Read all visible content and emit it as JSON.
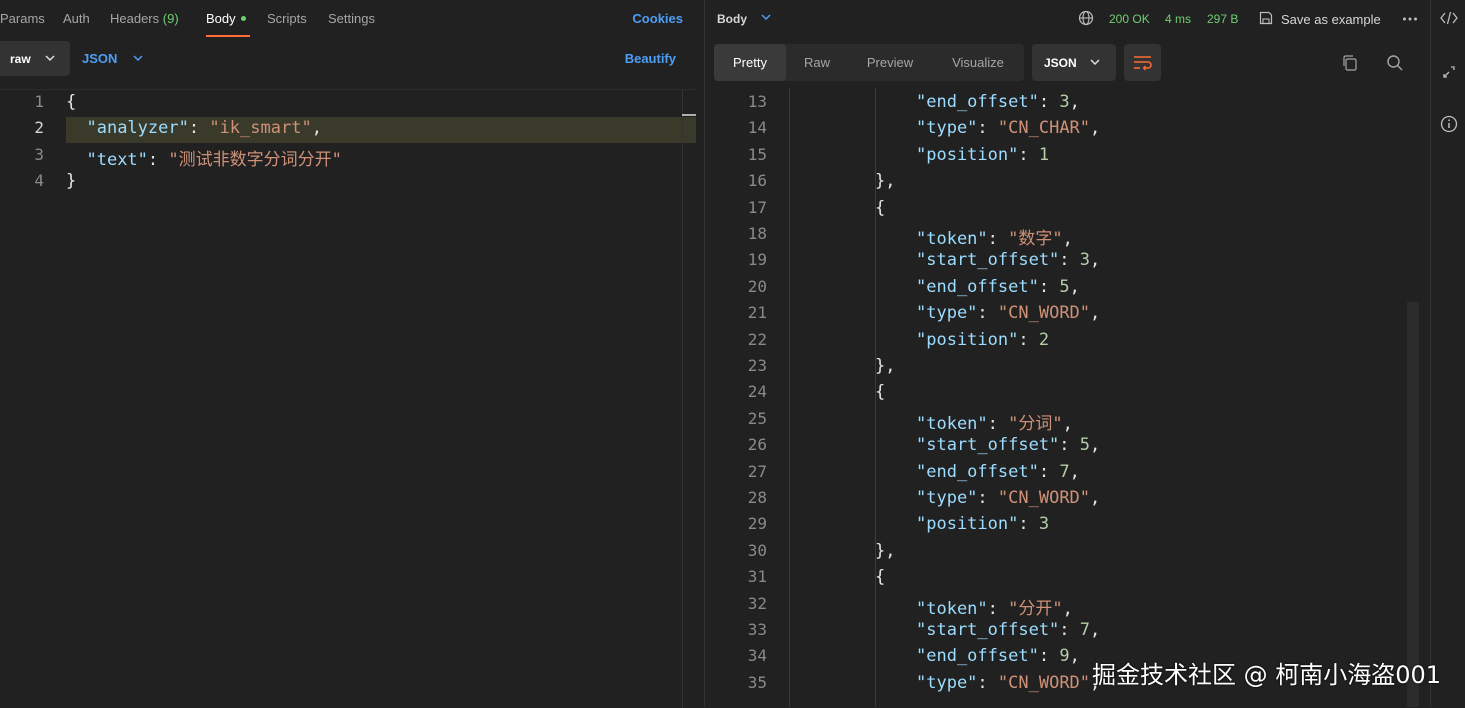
{
  "request_tabs": {
    "params": "Params",
    "auth": "Auth",
    "headers": "Headers",
    "headers_count": "(9)",
    "body": "Body",
    "scripts": "Scripts",
    "settings": "Settings",
    "cookies": "Cookies"
  },
  "body_toolbar": {
    "mode": "raw",
    "language": "JSON",
    "beautify": "Beautify"
  },
  "request_editor": {
    "lines": [
      {
        "n": "1",
        "parts": [
          {
            "t": "{",
            "c": "pun"
          }
        ]
      },
      {
        "n": "2",
        "parts": [
          {
            "t": "  ",
            "c": "pun"
          },
          {
            "t": "\"analyzer\"",
            "c": "key"
          },
          {
            "t": ": ",
            "c": "pun"
          },
          {
            "t": "\"ik_smart\"",
            "c": "str"
          },
          {
            "t": ",",
            "c": "pun"
          }
        ]
      },
      {
        "n": "3",
        "parts": [
          {
            "t": "  ",
            "c": "pun"
          },
          {
            "t": "\"text\"",
            "c": "key"
          },
          {
            "t": ": ",
            "c": "pun"
          },
          {
            "t": "\"测试非数字分词分开\"",
            "c": "str"
          }
        ]
      },
      {
        "n": "4",
        "parts": [
          {
            "t": "}",
            "c": "pun"
          }
        ]
      }
    ]
  },
  "response_header": {
    "body_label": "Body",
    "status": "200 OK",
    "time": "4 ms",
    "size": "297 B",
    "save_example": "Save as example"
  },
  "response_tabs": [
    "Pretty",
    "Raw",
    "Preview",
    "Visualize"
  ],
  "response_format": "JSON",
  "response_editor": {
    "lines": [
      {
        "n": "13",
        "indent": 2,
        "parts": [
          {
            "t": "\"end_offset\"",
            "c": "key"
          },
          {
            "t": ": ",
            "c": "pun"
          },
          {
            "t": "3",
            "c": "num"
          },
          {
            "t": ",",
            "c": "pun"
          }
        ]
      },
      {
        "n": "14",
        "indent": 2,
        "parts": [
          {
            "t": "\"type\"",
            "c": "key"
          },
          {
            "t": ": ",
            "c": "pun"
          },
          {
            "t": "\"CN_CHAR\"",
            "c": "str"
          },
          {
            "t": ",",
            "c": "pun"
          }
        ]
      },
      {
        "n": "15",
        "indent": 2,
        "parts": [
          {
            "t": "\"position\"",
            "c": "key"
          },
          {
            "t": ": ",
            "c": "pun"
          },
          {
            "t": "1",
            "c": "num"
          }
        ]
      },
      {
        "n": "16",
        "indent": 1,
        "parts": [
          {
            "t": "},",
            "c": "pun"
          }
        ]
      },
      {
        "n": "17",
        "indent": 1,
        "parts": [
          {
            "t": "{",
            "c": "pun"
          }
        ]
      },
      {
        "n": "18",
        "indent": 2,
        "parts": [
          {
            "t": "\"token\"",
            "c": "key"
          },
          {
            "t": ": ",
            "c": "pun"
          },
          {
            "t": "\"数字\"",
            "c": "str"
          },
          {
            "t": ",",
            "c": "pun"
          }
        ]
      },
      {
        "n": "19",
        "indent": 2,
        "parts": [
          {
            "t": "\"start_offset\"",
            "c": "key"
          },
          {
            "t": ": ",
            "c": "pun"
          },
          {
            "t": "3",
            "c": "num"
          },
          {
            "t": ",",
            "c": "pun"
          }
        ]
      },
      {
        "n": "20",
        "indent": 2,
        "parts": [
          {
            "t": "\"end_offset\"",
            "c": "key"
          },
          {
            "t": ": ",
            "c": "pun"
          },
          {
            "t": "5",
            "c": "num"
          },
          {
            "t": ",",
            "c": "pun"
          }
        ]
      },
      {
        "n": "21",
        "indent": 2,
        "parts": [
          {
            "t": "\"type\"",
            "c": "key"
          },
          {
            "t": ": ",
            "c": "pun"
          },
          {
            "t": "\"CN_WORD\"",
            "c": "str"
          },
          {
            "t": ",",
            "c": "pun"
          }
        ]
      },
      {
        "n": "22",
        "indent": 2,
        "parts": [
          {
            "t": "\"position\"",
            "c": "key"
          },
          {
            "t": ": ",
            "c": "pun"
          },
          {
            "t": "2",
            "c": "num"
          }
        ]
      },
      {
        "n": "23",
        "indent": 1,
        "parts": [
          {
            "t": "},",
            "c": "pun"
          }
        ]
      },
      {
        "n": "24",
        "indent": 1,
        "parts": [
          {
            "t": "{",
            "c": "pun"
          }
        ]
      },
      {
        "n": "25",
        "indent": 2,
        "parts": [
          {
            "t": "\"token\"",
            "c": "key"
          },
          {
            "t": ": ",
            "c": "pun"
          },
          {
            "t": "\"分词\"",
            "c": "str"
          },
          {
            "t": ",",
            "c": "pun"
          }
        ]
      },
      {
        "n": "26",
        "indent": 2,
        "parts": [
          {
            "t": "\"start_offset\"",
            "c": "key"
          },
          {
            "t": ": ",
            "c": "pun"
          },
          {
            "t": "5",
            "c": "num"
          },
          {
            "t": ",",
            "c": "pun"
          }
        ]
      },
      {
        "n": "27",
        "indent": 2,
        "parts": [
          {
            "t": "\"end_offset\"",
            "c": "key"
          },
          {
            "t": ": ",
            "c": "pun"
          },
          {
            "t": "7",
            "c": "num"
          },
          {
            "t": ",",
            "c": "pun"
          }
        ]
      },
      {
        "n": "28",
        "indent": 2,
        "parts": [
          {
            "t": "\"type\"",
            "c": "key"
          },
          {
            "t": ": ",
            "c": "pun"
          },
          {
            "t": "\"CN_WORD\"",
            "c": "str"
          },
          {
            "t": ",",
            "c": "pun"
          }
        ]
      },
      {
        "n": "29",
        "indent": 2,
        "parts": [
          {
            "t": "\"position\"",
            "c": "key"
          },
          {
            "t": ": ",
            "c": "pun"
          },
          {
            "t": "3",
            "c": "num"
          }
        ]
      },
      {
        "n": "30",
        "indent": 1,
        "parts": [
          {
            "t": "},",
            "c": "pun"
          }
        ]
      },
      {
        "n": "31",
        "indent": 1,
        "parts": [
          {
            "t": "{",
            "c": "pun"
          }
        ]
      },
      {
        "n": "32",
        "indent": 2,
        "parts": [
          {
            "t": "\"token\"",
            "c": "key"
          },
          {
            "t": ": ",
            "c": "pun"
          },
          {
            "t": "\"分开\"",
            "c": "str"
          },
          {
            "t": ",",
            "c": "pun"
          }
        ]
      },
      {
        "n": "33",
        "indent": 2,
        "parts": [
          {
            "t": "\"start_offset\"",
            "c": "key"
          },
          {
            "t": ": ",
            "c": "pun"
          },
          {
            "t": "7",
            "c": "num"
          },
          {
            "t": ",",
            "c": "pun"
          }
        ]
      },
      {
        "n": "34",
        "indent": 2,
        "parts": [
          {
            "t": "\"end_offset\"",
            "c": "key"
          },
          {
            "t": ": ",
            "c": "pun"
          },
          {
            "t": "9",
            "c": "num"
          },
          {
            "t": ",",
            "c": "pun"
          }
        ]
      },
      {
        "n": "35",
        "indent": 2,
        "parts": [
          {
            "t": "\"type\"",
            "c": "key"
          },
          {
            "t": ": ",
            "c": "pun"
          },
          {
            "t": "\"CN_WORD\"",
            "c": "str"
          },
          {
            "t": ",",
            "c": "pun"
          }
        ]
      }
    ]
  },
  "watermark": "掘金技术社区 @ 柯南小海盗001",
  "colors": {
    "accent_orange": "#ff6c37",
    "link_blue": "#4d9ef7",
    "status_green": "#6fcf72"
  },
  "icons": {
    "globe": "globe-icon",
    "save": "save-icon",
    "more": "more-horizontal-icon",
    "wrap": "wrap-lines-icon",
    "copy": "copy-icon",
    "search": "search-icon",
    "code": "code-icon",
    "expand": "expand-icon",
    "info": "info-icon"
  }
}
